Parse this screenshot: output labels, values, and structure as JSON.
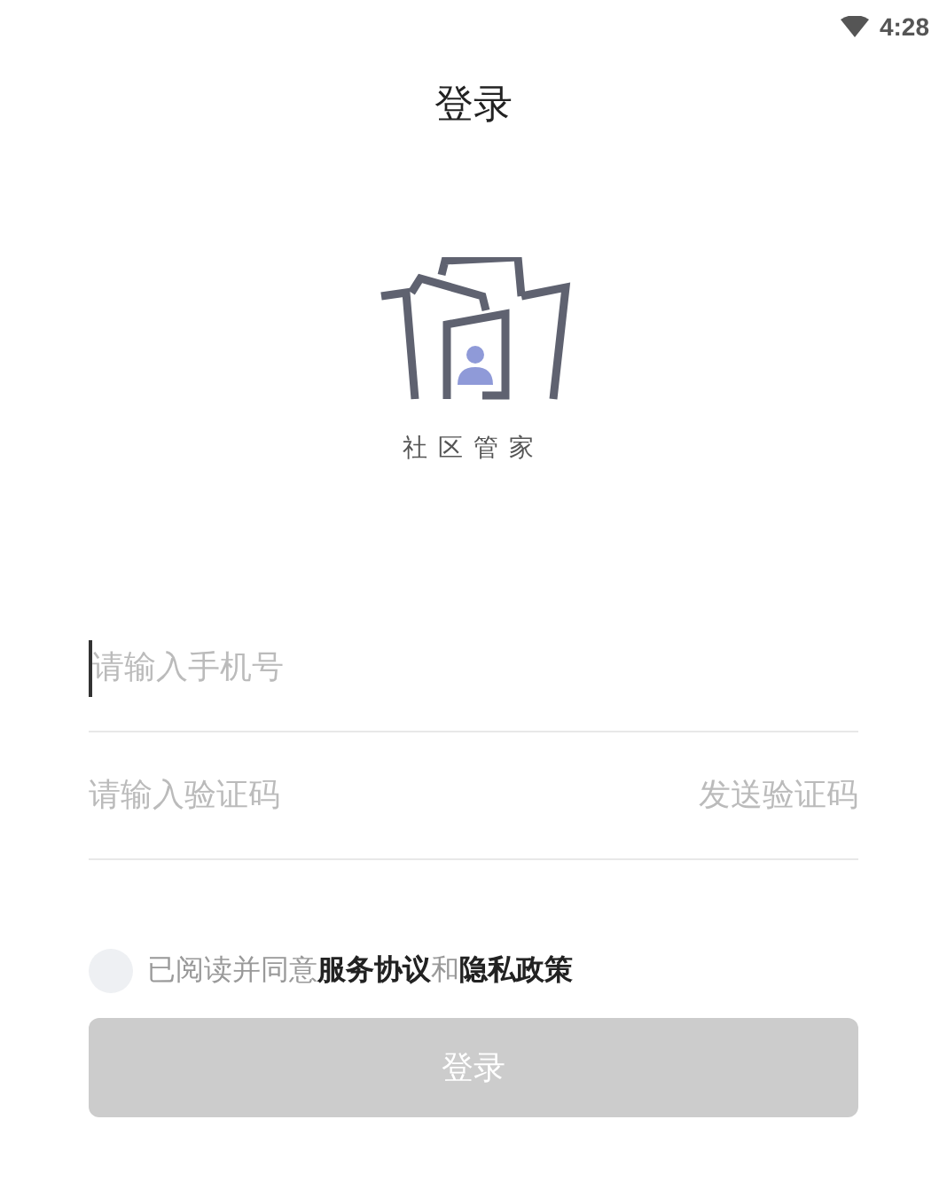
{
  "status_bar": {
    "time": "4:28"
  },
  "title": "登录",
  "logo": {
    "caption": "社区管家"
  },
  "phone_field": {
    "placeholder": "请输入手机号",
    "focused": true
  },
  "code_field": {
    "placeholder": "请输入验证码"
  },
  "send_code_button": {
    "label": "发送验证码"
  },
  "agreement": {
    "checked": false,
    "prefix": "已阅读并同意",
    "links": [
      {
        "label": "服务协议"
      },
      {
        "label": "隐私政策"
      }
    ],
    "joiner": "和"
  },
  "login_button": {
    "label": "登录",
    "disabled": true
  }
}
